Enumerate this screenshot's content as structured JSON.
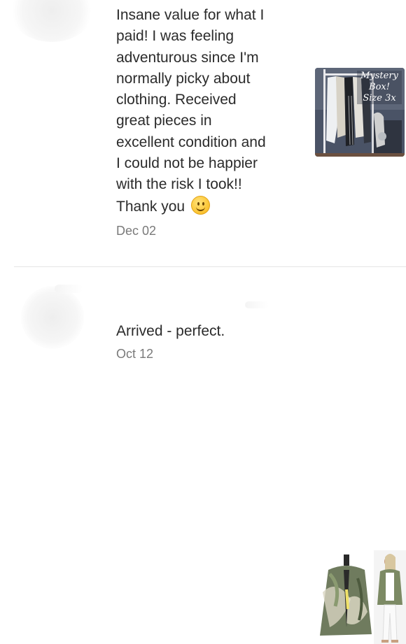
{
  "reviews": [
    {
      "text": "Insane value for what I\npaid! I was feeling\nadventurous since I'm\nnormally picky about\nclothing. Received\ngreat pieces in\nexcellent condition and\nI could not be happier\nwith the risk I took!!\nThank you",
      "emoji": "slightly-smiling-face",
      "date": "Dec 02",
      "thumbnail": {
        "label_lines": [
          "Mystery",
          "Box!",
          "Size 3x"
        ],
        "icon": "clothing-rack-photo"
      }
    },
    {
      "text": "Arrived - perfect.",
      "date": "Oct 12",
      "thumbnail": {
        "icon": "kimono-cardigan-photo"
      }
    }
  ],
  "colors": {
    "text": "#2b2b2b",
    "date": "#7a7a7a",
    "divider": "#e5e5e5",
    "background": "#ffffff"
  }
}
